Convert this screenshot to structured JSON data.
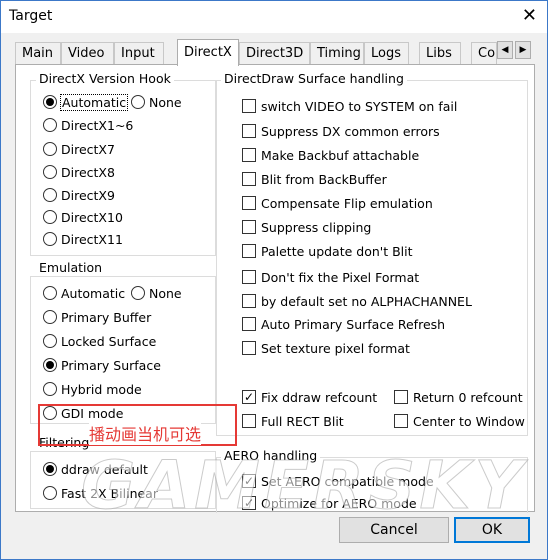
{
  "window": {
    "title": "Target"
  },
  "tabs": [
    "Main",
    "Video",
    "Input",
    "DirectX",
    "Direct3D",
    "Timing",
    "Logs",
    "Libs",
    "Co"
  ],
  "active_tab": "DirectX",
  "groups": {
    "version_hook": "DirectX Version Hook",
    "emulation": "Emulation",
    "filtering": "Filtering",
    "ddraw": "DirectDraw Surface handling",
    "aero": "AERO handling"
  },
  "version_hook": [
    {
      "label": "Automatic",
      "checked": true
    },
    {
      "label": "None",
      "checked": false
    },
    {
      "label": "DirectX1~6",
      "checked": false
    },
    {
      "label": "DirectX7",
      "checked": false
    },
    {
      "label": "DirectX8",
      "checked": false
    },
    {
      "label": "DirectX9",
      "checked": false
    },
    {
      "label": "DirectX10",
      "checked": false
    },
    {
      "label": "DirectX11",
      "checked": false
    }
  ],
  "emulation": [
    {
      "label": "Automatic",
      "checked": false
    },
    {
      "label": "None",
      "checked": false
    },
    {
      "label": "Primary Buffer",
      "checked": false
    },
    {
      "label": "Locked Surface",
      "checked": false
    },
    {
      "label": "Primary Surface",
      "checked": true
    },
    {
      "label": "Hybrid mode",
      "checked": false
    },
    {
      "label": "GDI mode",
      "checked": false
    }
  ],
  "filtering": [
    {
      "label": "ddraw default",
      "checked": true
    },
    {
      "label": "Fast 2X Bilinear",
      "checked": false
    }
  ],
  "ddraw": [
    {
      "label": "switch VIDEO to SYSTEM on fail",
      "checked": false
    },
    {
      "label": "Suppress DX common errors",
      "checked": false
    },
    {
      "label": "Make Backbuf attachable",
      "checked": false
    },
    {
      "label": "Blit from BackBuffer",
      "checked": false
    },
    {
      "label": "Compensate Flip emulation",
      "checked": false
    },
    {
      "label": "Suppress clipping",
      "checked": false
    },
    {
      "label": "Palette update don't Blit",
      "checked": false
    },
    {
      "label": "Don't fix the Pixel Format",
      "checked": false
    },
    {
      "label": "by default set no ALPHACHANNEL",
      "checked": false
    },
    {
      "label": "Auto Primary Surface Refresh",
      "checked": false
    },
    {
      "label": "Set texture pixel format",
      "checked": false
    },
    {
      "label": "Fix ddraw refcount",
      "checked": true
    },
    {
      "label": "Return 0 refcount",
      "checked": false
    },
    {
      "label": "Full RECT Blit",
      "checked": false
    },
    {
      "label": "Center to Window",
      "checked": false
    }
  ],
  "aero": [
    {
      "label": "Set AERO compatible mode",
      "checked": true
    },
    {
      "label": "Optimize for AERO mode",
      "checked": true
    }
  ],
  "annotation": "播动画当机可选",
  "watermark": "GAMERSKY",
  "buttons": {
    "cancel": "Cancel",
    "ok": "OK"
  },
  "colors": {
    "accent": "#0078d7",
    "annotation": "#e53935"
  },
  "icons": {
    "close": "close-icon",
    "left": "arrow-left-icon",
    "right": "arrow-right-icon"
  }
}
